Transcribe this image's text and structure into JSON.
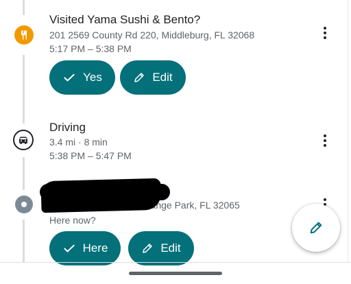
{
  "timeline": [
    {
      "type": "place",
      "title": "Visited Yama Sushi & Bento?",
      "address": "201 2569 County Rd 220, Middleburg, FL 32068",
      "time": "5:17 PM – 5:38 PM",
      "icon": "restaurant-icon",
      "buttons": [
        {
          "label": "Yes",
          "icon": "check-icon"
        },
        {
          "label": "Edit",
          "icon": "pencil-icon"
        }
      ]
    },
    {
      "type": "activity",
      "title": "Driving",
      "detail": "3.4 mi · 8 min",
      "time": "5:38 PM – 5:47 PM",
      "icon": "car-icon"
    },
    {
      "type": "place",
      "address_partial": "Orange Park, FL 32065",
      "status": "Here now?",
      "icon": "location-dot-icon",
      "buttons": [
        {
          "label": "Here",
          "icon": "check-icon"
        },
        {
          "label": "Edit",
          "icon": "pencil-icon"
        }
      ]
    }
  ],
  "fab": {
    "icon": "pencil-icon"
  },
  "colors": {
    "accent": "#03707a",
    "food": "#f29900",
    "place_dot": "#7c8a97"
  }
}
